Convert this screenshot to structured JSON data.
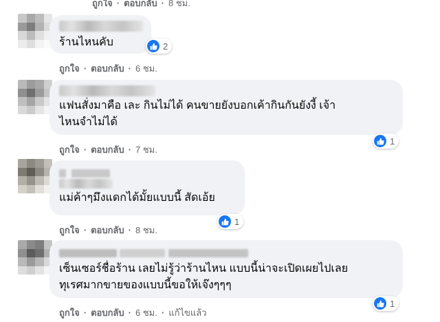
{
  "top_actions": {
    "like": "ถูกใจ",
    "dot": "·",
    "reply": "ตอบกลับ",
    "time": "8 ชม."
  },
  "comments": [
    {
      "text": "ร้านไหนคับ",
      "reactions": "2",
      "actions": {
        "like": "ถูกใจ",
        "dot": "·",
        "reply": "ตอบกลับ",
        "time": "6 ชม."
      }
    },
    {
      "text": "แฟนสั่งมาคือ เละ กินไม่ได้ คนขายยังบอกเค้ากินกันยังงี้ เจ้า\nไหนจำไม่ได้",
      "reactions": "1",
      "actions": {
        "like": "ถูกใจ",
        "dot": "·",
        "reply": "ตอบกลับ",
        "time": "7 ชม."
      }
    },
    {
      "text": "แม่ค้าๆมึงแดกได้มั้ยแบบนี้ สัดเอ้ย",
      "reactions": "1",
      "actions": {
        "like": "ถูกใจ",
        "dot": "·",
        "reply": "ตอบกลับ",
        "time": "8 ชม."
      }
    },
    {
      "text": "เซ็นเซอร์ชื่อร้าน เลยไม่รู้ว่าร้านไหน แบบนี้น่าจะเปิดเผยไปเลย\nทุเรศมากขายของแบบนี้ขอให้เจ๊งๆๆๆ",
      "reactions": "1",
      "actions": {
        "like": "ถูกใจ",
        "dot": "·",
        "reply": "ตอบกลับ",
        "time": "6 ชม.",
        "dot2": "·",
        "edited": "แก้ไขแล้ว"
      }
    }
  ],
  "colors": {
    "bubble": "#f0f2f5",
    "like_blue": "#1877f2",
    "meta_text": "#65676b",
    "body_text": "#050505"
  },
  "icons": {
    "reaction": "like-thumb-icon"
  }
}
